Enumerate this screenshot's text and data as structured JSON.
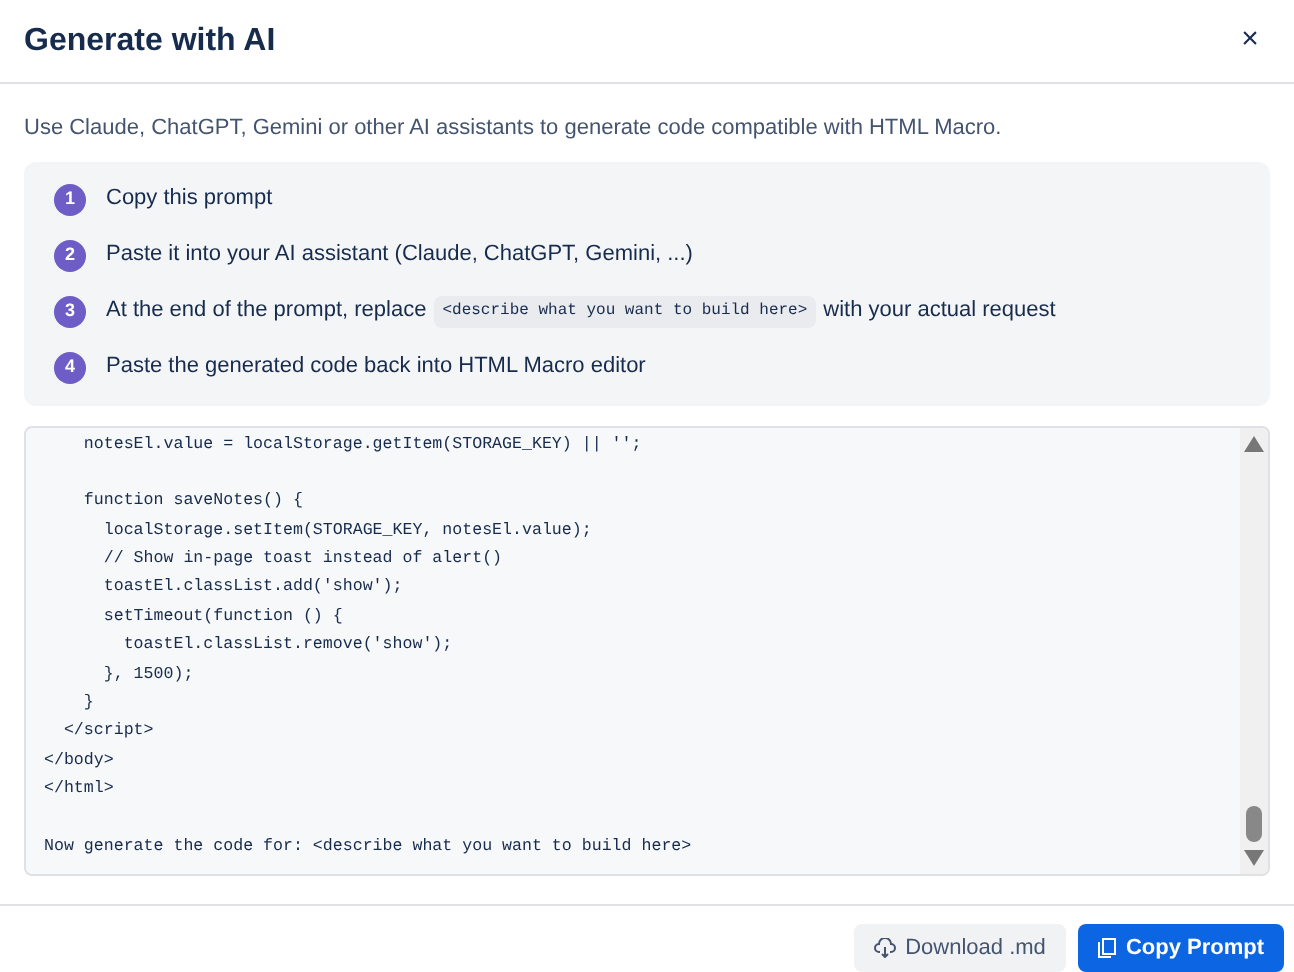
{
  "dialog": {
    "title": "Generate with AI",
    "close": "×"
  },
  "description": "Use Claude, ChatGPT, Gemini or other AI assistants to generate code compatible with HTML Macro.",
  "steps": [
    {
      "number": "1",
      "parts": [
        {
          "kind": "text",
          "text": "Copy this prompt"
        }
      ]
    },
    {
      "number": "2",
      "parts": [
        {
          "kind": "text",
          "text": "Paste it into your AI assistant (Claude, ChatGPT, Gemini, ...)"
        }
      ]
    },
    {
      "number": "3",
      "parts": [
        {
          "kind": "text",
          "text": "At the end of the prompt, replace"
        },
        {
          "kind": "code",
          "text": "<describe what you want to build here>"
        },
        {
          "kind": "text",
          "text": "with your actual request"
        }
      ]
    },
    {
      "number": "4",
      "parts": [
        {
          "kind": "text",
          "text": "Paste the generated code back into HTML Macro editor"
        }
      ]
    }
  ],
  "code_blocks": [
    [
      "    notesEl.value = localStorage.getItem(STORAGE_KEY) || '';"
    ],
    [
      "    function saveNotes() {",
      "      localStorage.setItem(STORAGE_KEY, notesEl.value);",
      "      // Show in-page toast instead of alert()",
      "      toastEl.classList.add('show');",
      "      setTimeout(function () {",
      "        toastEl.classList.remove('show');",
      "      }, 1500);",
      "    }",
      "  </script>",
      "</body>",
      "</html>"
    ],
    [
      "Now generate the code for: <describe what you want to build here>"
    ]
  ],
  "buttons": [
    {
      "label": "Download .md",
      "kind": "secondary"
    },
    {
      "label": "Copy Prompt",
      "kind": "primary"
    }
  ]
}
